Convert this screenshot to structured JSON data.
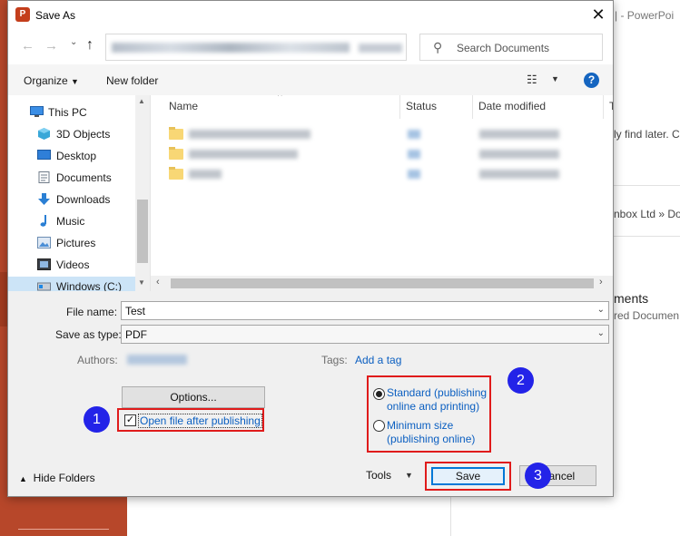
{
  "window": {
    "title": "Save As",
    "app_icon_letter": "P",
    "close_symbol": "✕"
  },
  "background": {
    "title": "| - PowerPoi",
    "side_text_1": "ly find later. C",
    "side_text_2": "nbox Ltd » Do",
    "side_text_3": "ments",
    "side_text_4": "red Documen"
  },
  "navbar": {
    "back_icon": "back-arrow-icon",
    "forward_icon": "forward-arrow-icon",
    "up_icon": "up-arrow-icon",
    "search_placeholder": "Search Documents"
  },
  "toolbar": {
    "organize_label": "Organize",
    "new_folder_label": "New folder",
    "help_label": "?"
  },
  "sidebar": {
    "items": [
      {
        "label": "This PC",
        "icon": "pc-icon"
      },
      {
        "label": "3D Objects",
        "icon": "cube-icon"
      },
      {
        "label": "Desktop",
        "icon": "desktop-icon"
      },
      {
        "label": "Documents",
        "icon": "documents-icon"
      },
      {
        "label": "Downloads",
        "icon": "download-icon"
      },
      {
        "label": "Music",
        "icon": "music-icon"
      },
      {
        "label": "Pictures",
        "icon": "pictures-icon"
      },
      {
        "label": "Videos",
        "icon": "video-icon"
      },
      {
        "label": "Windows (C:)",
        "icon": "drive-icon"
      }
    ]
  },
  "files": {
    "columns": [
      "Name",
      "Status",
      "Date modified",
      "T"
    ]
  },
  "form": {
    "file_name_label": "File name:",
    "file_name_value": "Test",
    "save_type_label": "Save as type:",
    "save_type_value": "PDF",
    "authors_label": "Authors:",
    "tags_label": "Tags:",
    "add_tag_label": "Add a tag"
  },
  "options": {
    "options_button": "Options...",
    "open_after_label": "Open file after publishing",
    "open_after_checked": true,
    "radio_standard": "Standard (publishing online and printing)",
    "radio_minimum": "Minimum size (publishing online)",
    "selected_radio": "standard"
  },
  "footer": {
    "hide_folders_label": "Hide Folders",
    "tools_label": "Tools",
    "save_label": "Save",
    "cancel_label": "Cancel"
  },
  "badges": [
    "1",
    "2",
    "3"
  ],
  "colors": {
    "accent_blue": "#0078d7",
    "link_blue": "#0b5fc1",
    "highlight_red": "#e01b1b",
    "badge_blue": "#2323e8",
    "ppt_orange": "#b7472a"
  }
}
